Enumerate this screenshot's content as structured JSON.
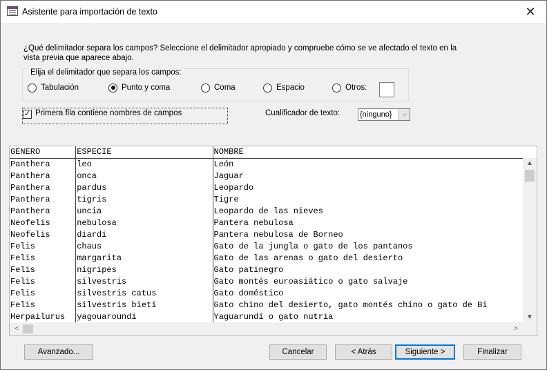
{
  "window": {
    "title": "Asistente para importación de texto",
    "close_glyph": "✕"
  },
  "intro": "¿Qué delimitador separa los campos? Seleccione el delimitador apropiado y compruebe cómo se ve afectado el texto en la vista previa que aparece abajo.",
  "delimiter_group": {
    "legend": "Elija el delimitador que separa los campos:",
    "options": [
      {
        "label": "Tabulación",
        "selected": false
      },
      {
        "label": "Punto y coma",
        "selected": true
      },
      {
        "label": "Coma",
        "selected": false
      },
      {
        "label": "Espacio",
        "selected": false
      },
      {
        "label": "Otros:",
        "selected": false
      }
    ],
    "otros_value": ""
  },
  "first_row": {
    "label": "Primera fila contiene nombres de campos",
    "checked": true,
    "check_glyph": "✓"
  },
  "qualifier": {
    "label": "Cualificador de texto:",
    "value": "{ninguno}",
    "arrow": "⌵"
  },
  "preview": {
    "columns": [
      "GENERO",
      "ESPECIE",
      "NOMBRE"
    ],
    "rows": [
      [
        "Panthera",
        "leo",
        "León"
      ],
      [
        "Panthera",
        "onca",
        "Jaguar"
      ],
      [
        "Panthera",
        "pardus",
        "Leopardo"
      ],
      [
        "Panthera",
        "tigris",
        "Tigre"
      ],
      [
        "Panthera",
        "uncia",
        "Leopardo de las nieves"
      ],
      [
        "Neofelis",
        "nebulosa",
        "Pantera nebulosa"
      ],
      [
        "Neofelis",
        "diardi",
        "Pantera nebulosa de Borneo"
      ],
      [
        "Felis",
        "chaus",
        "Gato de la jungla o gato de los pantanos"
      ],
      [
        "Felis",
        "margarita",
        "Gato de las arenas o gato del desierto"
      ],
      [
        "Felis",
        "nigripes",
        "Gato patinegro"
      ],
      [
        "Felis",
        "silvestris",
        "Gato montés euroasiático o gato salvaje"
      ],
      [
        "Felis",
        "silvestris catus",
        "Gato doméstico"
      ],
      [
        "Felis",
        "silvestris bieti",
        "Gato chino del desierto, gato montés chino o gato de Bi"
      ],
      [
        "Herpailurus",
        "yagouaroundi",
        "Yaguarundí o gato nutria"
      ]
    ],
    "scroll_up": "▲",
    "scroll_down": "▼",
    "scroll_left": "<",
    "scroll_right": ">"
  },
  "buttons": {
    "advanced": "Avanzado...",
    "cancel": "Cancelar",
    "back": "< Atrás",
    "next": "Siguiente >",
    "finish": "Finalizar"
  }
}
